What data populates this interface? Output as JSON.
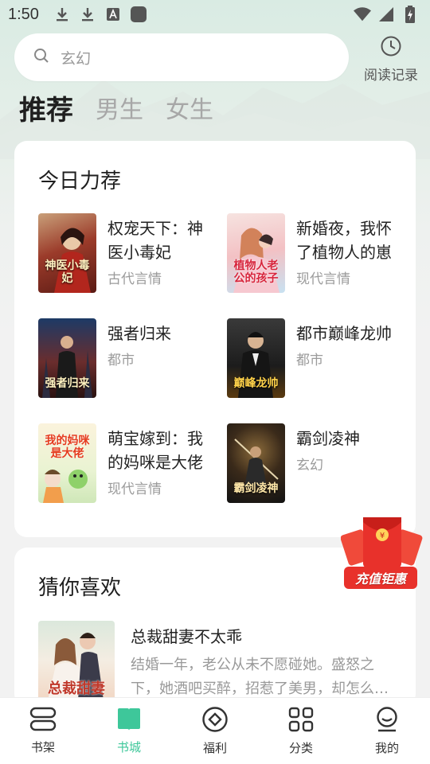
{
  "status_bar": {
    "time": "1:50",
    "left_icons": [
      "download-icon",
      "download-icon",
      "font-icon",
      "app-icon"
    ],
    "right_icons": [
      "wifi-icon",
      "signal-icon",
      "battery-icon"
    ]
  },
  "search": {
    "placeholder": "玄幻",
    "history_label": "阅读记录"
  },
  "tabs": [
    {
      "label": "推荐",
      "active": true
    },
    {
      "label": "男生",
      "active": false
    },
    {
      "label": "女生",
      "active": false
    }
  ],
  "today_picks": {
    "title": "今日力荐",
    "books": [
      {
        "title": "权宠天下：神医小毒妃",
        "genre": "古代言情",
        "cover_text": "神医小毒妃"
      },
      {
        "title": "新婚夜，我怀了植物人的崽",
        "genre": "现代言情",
        "cover_text": "植物人老公的孩子"
      },
      {
        "title": "强者归来",
        "genre": "都市",
        "cover_text": "强者归来"
      },
      {
        "title": "都市巅峰龙帅",
        "genre": "都市",
        "cover_text": "巅峰龙帅"
      },
      {
        "title": "萌宝嫁到：我的妈咪是大佬",
        "genre": "现代言情",
        "cover_text": "我的妈咪是大佬"
      },
      {
        "title": "霸剑凌神",
        "genre": "玄幻",
        "cover_text": "霸剑凌神"
      }
    ]
  },
  "promo": {
    "label": "充值钜惠"
  },
  "guess_you_like": {
    "title": "猜你喜欢",
    "item": {
      "title": "总裁甜妻不太乖",
      "description": "结婚一年，老公从未不愿碰她。盛怒之下，她酒吧买醉，招惹了美男，却怎么也甩不掉……",
      "cover_text": "总裁甜妻"
    }
  },
  "bottom_nav": [
    {
      "label": "书架",
      "icon": "bookshelf-icon",
      "active": false
    },
    {
      "label": "书城",
      "icon": "bookstore-icon",
      "active": true
    },
    {
      "label": "福利",
      "icon": "welfare-icon",
      "active": false
    },
    {
      "label": "分类",
      "icon": "category-icon",
      "active": false
    },
    {
      "label": "我的",
      "icon": "profile-icon",
      "active": false
    }
  ],
  "colors": {
    "accent": "#3ec79a",
    "promo_red": "#e8312b"
  }
}
